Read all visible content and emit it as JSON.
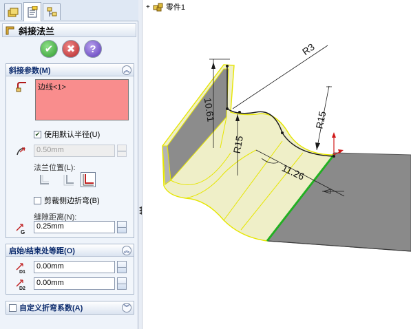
{
  "feature": {
    "title": "斜接法兰",
    "buttons": {
      "ok": "✔",
      "cancel": "✖",
      "help": "?"
    }
  },
  "tabs": [
    {
      "name": "feature-manager",
      "icon": "feature-tree-icon"
    },
    {
      "name": "property-manager",
      "icon": "property-manager-icon"
    },
    {
      "name": "configuration-manager",
      "icon": "configuration-icon"
    }
  ],
  "miter_params": {
    "header": "斜接参数(M)",
    "selection": "边线<1>",
    "use_default_radius_label": "使用默认半径(U)",
    "use_default_radius_checked": true,
    "radius_value": "0.50mm",
    "flange_position_label": "法兰位置(L):",
    "flange_position_selected": "outside",
    "trim_side_bends_label": "剪裁侧边折弯(B)",
    "trim_side_bends_checked": false,
    "gap_distance_label": "缝隙距离(N):",
    "gap_distance_value": "0.25mm"
  },
  "start_end_offset": {
    "header": "启始/结束处等距(O)",
    "d1_value": "0.00mm",
    "d2_value": "0.00mm",
    "d1_label": "D1",
    "d2_label": "D2"
  },
  "custom_bend": {
    "header": "自定义折弯系数(A)",
    "checked": false
  },
  "gap_icon_label": "G",
  "tree": {
    "expander": "+",
    "part_name": "零件1"
  },
  "dimensions": {
    "r3": "R3",
    "d10_61": "10.61",
    "r15_left": "R15",
    "r15_right": "R15",
    "d11_26": "11.26"
  },
  "colors": {
    "selection_box": "#f98d8d",
    "preview_fill": "#efefc8",
    "preview_edge": "#f0f000",
    "selected_edge": "#22b022",
    "model_face": "#8a8a8a"
  }
}
